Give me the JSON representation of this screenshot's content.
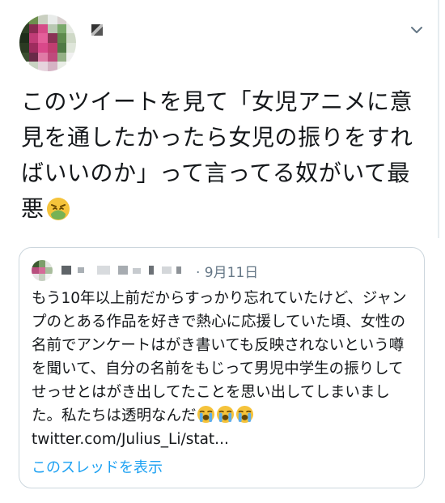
{
  "tweet": {
    "author_name": "",
    "author_handle": "",
    "text": "このツイートを見て「女児アニメに意見を通したかったら女児の振りをすればいいのか」って言ってる奴がいて最悪",
    "emoji": "nauseated-face-icon",
    "menu_icon": "chevron-down-icon"
  },
  "quoted_tweet": {
    "date": "· 9月11日",
    "text": "もう10年以上前だからすっかり忘れていたけど、ジャンプのとある作品を好きで熱心に応援していた頃、女性の名前でアンケートはがき書いても反映されないという噂を聞いて、自分の名前をもじって男児中学生の振りしてせっせとはがき出してたことを思い出してしまいました。私たちは透明なんだ",
    "emoji": "loudly-crying-face-icon",
    "link": "twitter.com/Julius_Li/stat...",
    "show_thread": "このスレッドを表示"
  },
  "colors": {
    "text": "#14171a",
    "secondary": "#657786",
    "link": "#1da1f2",
    "border": "#ccd6dd",
    "nausea_face": "#f5c33b",
    "nausea_green": "#77b255"
  }
}
